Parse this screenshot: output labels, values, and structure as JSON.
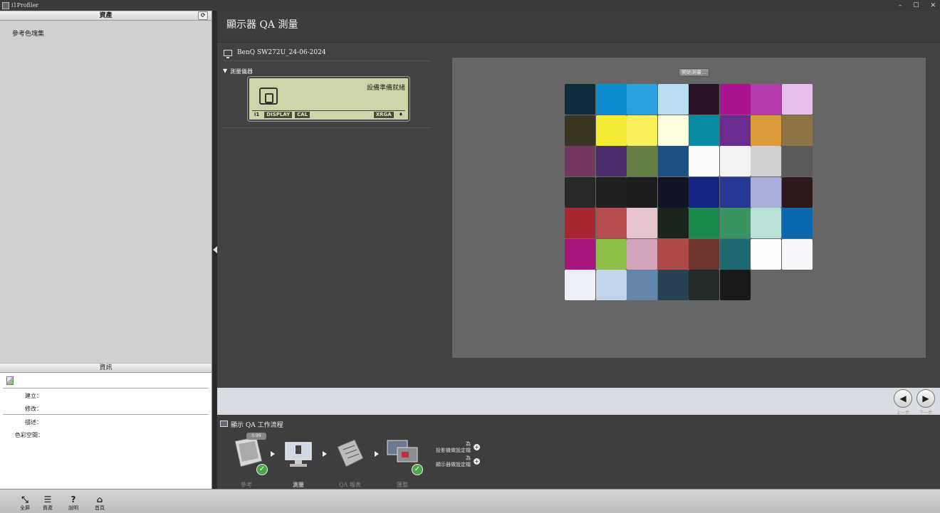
{
  "window": {
    "title": "i1Profiler"
  },
  "left_panel": {
    "assets_header": "資產",
    "asset_items": [
      "參考色塊集"
    ],
    "info_header": "資訊",
    "info_labels": {
      "created": "建立：",
      "modified": "修改：",
      "description": "描述：",
      "colorspace": "色彩空間："
    }
  },
  "main": {
    "page_title": "顯示器 QA 測量",
    "display_name": "BenQ SW272U_24-06-2024",
    "device_section_title": "測量儀器",
    "lcd": {
      "status": "設備準備就緒",
      "tag1": "DISPLAY",
      "tag2": "CAL",
      "tag3": "XRGA"
    },
    "start_button": "開始測量..."
  },
  "patches": [
    [
      "#102a3a",
      "#0a8cce",
      "#28a0dc",
      "#b8dcf2",
      "#2a1428",
      "#aa1490",
      "#b43cac",
      "#e6c0e8"
    ],
    [
      "#3a3420",
      "#f4ec32",
      "#f8f05a",
      "#fefee0",
      "#068ca0",
      "#6a2c90",
      "#dc9a3a",
      "#8c7444"
    ],
    [
      "#743860",
      "#4c2c6c",
      "#668044",
      "#1c5080",
      "#fcfcfc",
      "#f2f2f4",
      "#d0d0d2",
      "#5a5a5a"
    ],
    [
      "#282828",
      "#1e2020",
      "#1c1c1e",
      "#101424",
      "#182482",
      "#283894",
      "#a8aedc",
      "#2c1a1a"
    ],
    [
      "#a82830",
      "#b84c4c",
      "#e8c4ce",
      "#18241c",
      "#1a8a4c",
      "#389460",
      "#b8e0d8",
      "#0a68b0"
    ],
    [
      "#a8167c",
      "#8ebe48",
      "#d4a4bc",
      "#b04848",
      "#703430",
      "#1e6a70",
      "#fefefe",
      "#f8f8fc"
    ],
    [
      "#eef0f8",
      "#c4d4e8",
      "#6486a8",
      "#284050",
      "#222a2a",
      "#1a1a1a"
    ]
  ],
  "nav": {
    "prev_label": "上一步",
    "next_label": "下一步"
  },
  "workflow": {
    "title": "顯示 QA 工作流程",
    "steps": [
      "參考",
      "測量",
      "QA 報表",
      "匯整"
    ],
    "links": [
      {
        "line1": "為",
        "line2": "投影機做設定檔"
      },
      {
        "line1": "為",
        "line2": "顯示器做設定檔"
      }
    ],
    "badge": "0.99"
  },
  "toolbar": {
    "fullscreen": "全屏",
    "assets": "資產",
    "help": "說明",
    "home": "首頁"
  }
}
